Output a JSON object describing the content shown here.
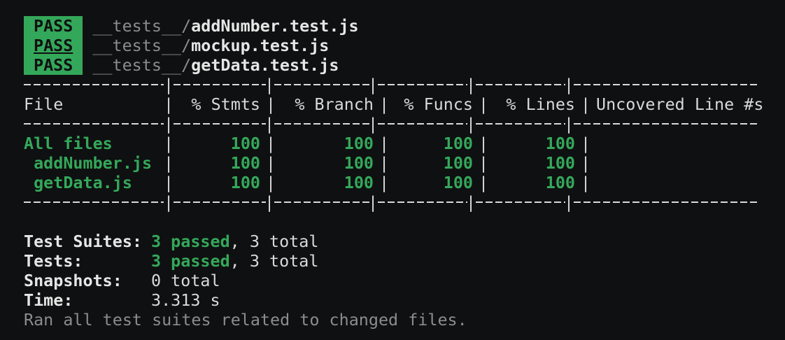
{
  "test_results": [
    {
      "status": "PASS",
      "dir": "__tests__/",
      "file": "addNumber.test.js"
    },
    {
      "status": "PASS",
      "dir": "__tests__/",
      "file": "mockup.test.js"
    },
    {
      "status": "PASS",
      "dir": "__tests__/",
      "file": "getData.test.js"
    }
  ],
  "coverage_table": {
    "headers": [
      "File",
      "% Stmts",
      "% Branch",
      "% Funcs",
      "% Lines",
      "Uncovered Line #s"
    ],
    "rows": [
      {
        "file": "All files",
        "stmts": "100",
        "branch": "100",
        "funcs": "100",
        "lines": "100",
        "uncovered": ""
      },
      {
        "file": " addNumber.js",
        "stmts": "100",
        "branch": "100",
        "funcs": "100",
        "lines": "100",
        "uncovered": ""
      },
      {
        "file": " getData.js",
        "stmts": "100",
        "branch": "100",
        "funcs": "100",
        "lines": "100",
        "uncovered": ""
      }
    ]
  },
  "summary": {
    "suites_label": "Test Suites:",
    "suites_passed": "3 passed",
    "suites_total": ", 3 total",
    "tests_label": "Tests:",
    "tests_passed": "3 passed",
    "tests_total": ", 3 total",
    "snapshots_label": "Snapshots:",
    "snapshots_value": "0 total",
    "time_label": "Time:",
    "time_value": "3.313 s",
    "footer": "Ran all test suites related to changed files."
  },
  "colors": {
    "background": "#0f1011",
    "pass_green": "#34a85a",
    "text": "#d9d9d9",
    "dim": "#8c8c8c"
  }
}
